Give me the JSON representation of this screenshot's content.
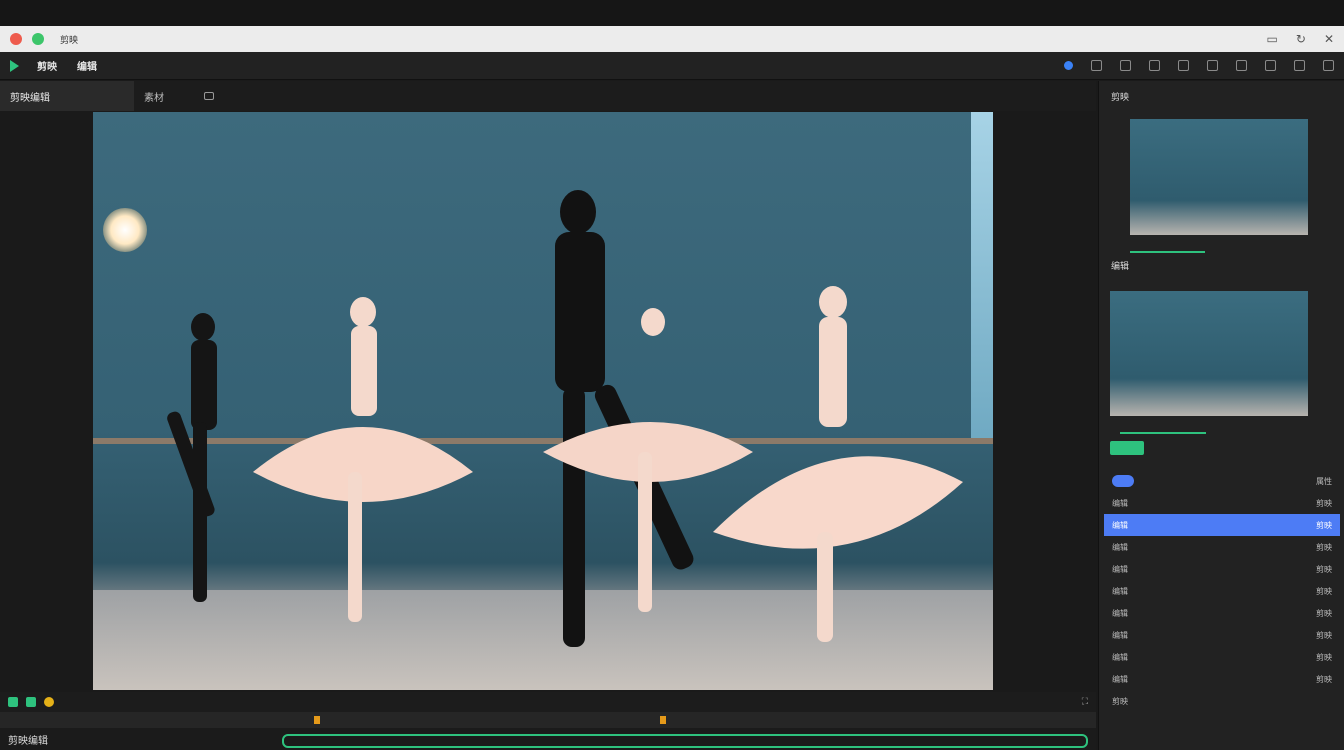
{
  "window": {
    "title": "剪映"
  },
  "toolbar": {
    "label1": "剪映",
    "label2": "编辑"
  },
  "tabs": [
    {
      "label": "剪映编辑"
    },
    {
      "label": "素材"
    }
  ],
  "timeline": {
    "label": "剪映编辑"
  },
  "right_panel": {
    "header": "剪映",
    "section": "编辑",
    "list_header": "属性",
    "list_items": [
      {
        "label": "编辑",
        "value": "剪映"
      },
      {
        "label": "编辑",
        "value": "剪映",
        "selected": true
      },
      {
        "label": "编辑",
        "value": "剪映"
      },
      {
        "label": "编辑",
        "value": "剪映"
      },
      {
        "label": "编辑",
        "value": "剪映"
      },
      {
        "label": "编辑",
        "value": "剪映"
      },
      {
        "label": "编辑",
        "value": "剪映"
      },
      {
        "label": "编辑",
        "value": "剪映"
      },
      {
        "label": "编辑",
        "value": "剪映"
      }
    ],
    "footer": "剪映"
  },
  "colors": {
    "accent_green": "#2ec27e",
    "accent_blue": "#4d7cf5",
    "accent_orange": "#e59a1a"
  }
}
